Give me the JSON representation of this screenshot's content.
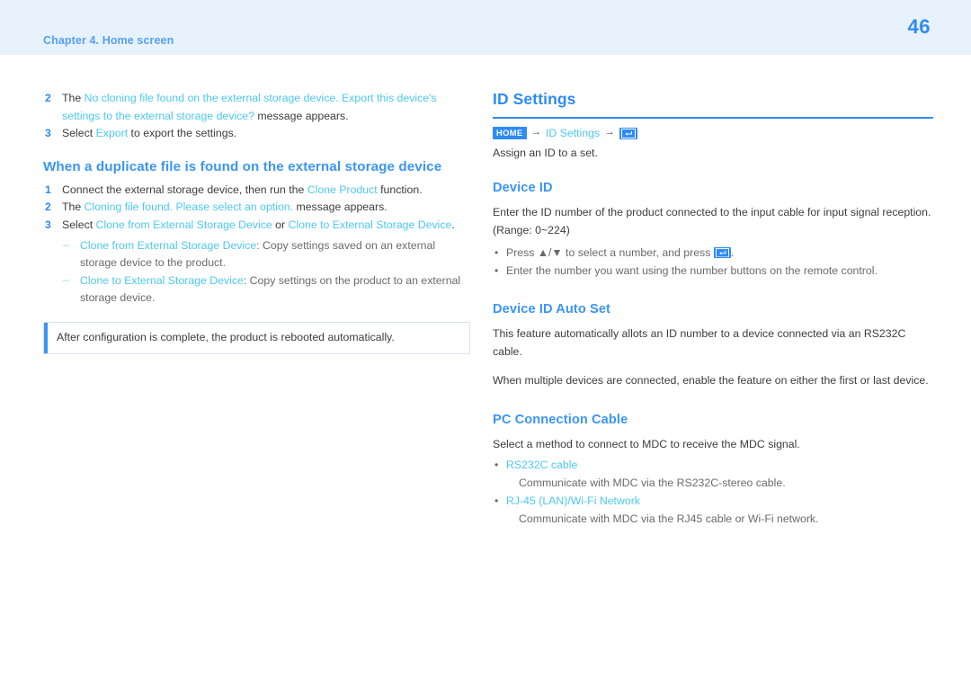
{
  "header": {
    "chapter": "Chapter 4. Home screen",
    "page_number": "46",
    "band_color": "#e8f2fd",
    "accent_color": "#2e8bf5"
  },
  "left_column": {
    "steps_top": [
      {
        "marker": "2",
        "lead": "The ",
        "highlight": "No cloning file found on the external storage device. Export this device's settings to the external storage device?",
        "tail": "  message appears."
      },
      {
        "marker": "3",
        "lead": "Select ",
        "highlight": "Export",
        "tail": " to export the settings."
      }
    ],
    "heading": "When a duplicate file is found on the external storage device",
    "steps": [
      {
        "marker": "1",
        "lead": "Connect the external storage device, then run the ",
        "highlight": "Clone Product",
        "tail": " function."
      },
      {
        "marker": "2",
        "lead": "The ",
        "highlight": "Cloning file found. Please select an option.",
        "tail": " message appears."
      },
      {
        "marker": "3",
        "lead": "Select ",
        "highlight": "Clone from External Storage Device",
        "mid": " or ",
        "highlight2": "Clone to External Storage Device",
        "tail": "."
      }
    ],
    "sub_items": [
      {
        "marker": "–",
        "highlight": "Clone from External Storage Device",
        "text": ": Copy settings saved on an external storage device to the product."
      },
      {
        "marker": "–",
        "highlight": "Clone to External Storage Device",
        "text": ": Copy settings on the product to an external storage device."
      }
    ],
    "note": "After configuration is complete, the product is rebooted automatically."
  },
  "right_column": {
    "section_title": "ID Settings",
    "breadcrumb": {
      "badge": "HOME",
      "arrow": "→",
      "item": "ID Settings",
      "arrow2": "→",
      "icon": "enter-key-icon"
    },
    "intro": "Assign an ID to a set.",
    "device_id": {
      "heading": "Device ID",
      "body": "Enter the ID number of the product connected to the input cable for input signal reception. (Range: 0~224)",
      "bullets": [
        {
          "lead": "Press ▲/▼ to select a number, and press ",
          "icon": "enter-key-icon",
          "tail": "."
        },
        {
          "lead": "Enter the number you want using the number buttons on the remote control.",
          "icon": "",
          "tail": ""
        }
      ]
    },
    "device_id_auto_set": {
      "heading": "Device ID Auto Set",
      "paragraph1": "This feature automatically allots an ID number to a device connected via an RS232C cable.",
      "paragraph2": "When multiple devices are connected, enable the feature on either the first or last device."
    },
    "pc_connection_cable": {
      "heading": "PC Connection Cable",
      "intro": "Select a method to connect to MDC to receive the MDC signal.",
      "options": [
        {
          "label": "RS232C cable",
          "description": "Communicate with MDC via the RS232C-stereo cable."
        },
        {
          "label": "RJ-45 (LAN)/Wi-Fi Network",
          "description": "Communicate with MDC via the RJ45 cable or Wi-Fi network."
        }
      ]
    }
  }
}
